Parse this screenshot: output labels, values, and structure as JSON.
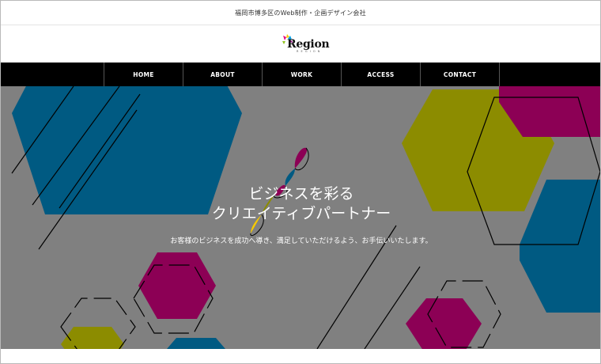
{
  "header": {
    "tagline": "福岡市博多区のWeb制作・企画デザイン会社",
    "logo_text": "Region",
    "logo_sub": "R E G I O N"
  },
  "nav": {
    "items": [
      {
        "label": "HOME"
      },
      {
        "label": "ABOUT"
      },
      {
        "label": "WORK"
      },
      {
        "label": "ACCESS"
      },
      {
        "label": "CONTACT"
      }
    ]
  },
  "hero": {
    "title_line1": "ビジネスを彩る",
    "title_line2": "クリエイティブパートナー",
    "subtitle": "お客様のビジネスを成功へ導き、満足していただけるよう、お手伝いいたします。"
  },
  "colors": {
    "hero_bg": "#808080",
    "blue": "#005a82",
    "olive": "#8c8c00",
    "magenta": "#8c0055",
    "nav_bg": "#000000"
  }
}
